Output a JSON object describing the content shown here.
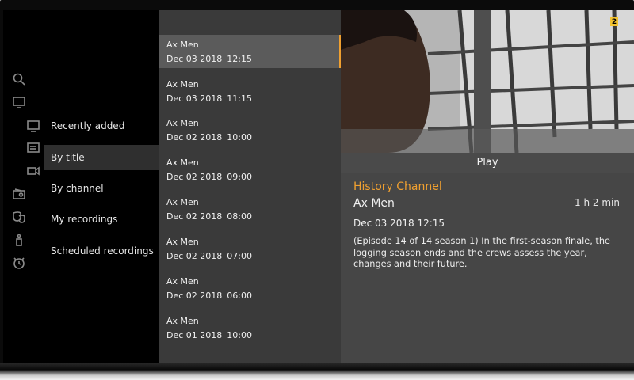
{
  "rail": {
    "icons": [
      "search-icon",
      "tv-icon",
      "tv-small-icon",
      "guide-icon",
      "camera-icon",
      "radio-icon",
      "theater-icon",
      "info-icon",
      "alarm-icon"
    ]
  },
  "submenu": {
    "items": [
      {
        "label": "Recently added"
      },
      {
        "label": "By title"
      },
      {
        "label": "By channel"
      },
      {
        "label": "My recordings"
      },
      {
        "label": "Scheduled recordings"
      }
    ],
    "selected": "By title"
  },
  "recordings": [
    {
      "title": "Ax Men",
      "date": "Dec 03 2018",
      "time": "12:15"
    },
    {
      "title": "Ax Men",
      "date": "Dec 03 2018",
      "time": "11:15"
    },
    {
      "title": "Ax Men",
      "date": "Dec 02 2018",
      "time": "10:00"
    },
    {
      "title": "Ax Men",
      "date": "Dec 02 2018",
      "time": "09:00"
    },
    {
      "title": "Ax Men",
      "date": "Dec 02 2018",
      "time": "08:00"
    },
    {
      "title": "Ax Men",
      "date": "Dec 02 2018",
      "time": "07:00"
    },
    {
      "title": "Ax Men",
      "date": "Dec 02 2018",
      "time": "06:00"
    },
    {
      "title": "Ax Men",
      "date": "Dec 01 2018",
      "time": "10:00"
    }
  ],
  "detail": {
    "badge": "2",
    "play_label": "Play",
    "channel": "History Channel",
    "title": "Ax Men",
    "duration": "1 h 2 min",
    "airdate": "Dec 03 2018  12:15",
    "description": "(Episode 14 of 14 season 1) In the first-season finale, the logging season ends and the crews assess the year, changes and their future."
  },
  "colors": {
    "accent": "#f0a030",
    "list_bg": "#3a3a3a",
    "selected_bg": "#5b5b5b"
  }
}
